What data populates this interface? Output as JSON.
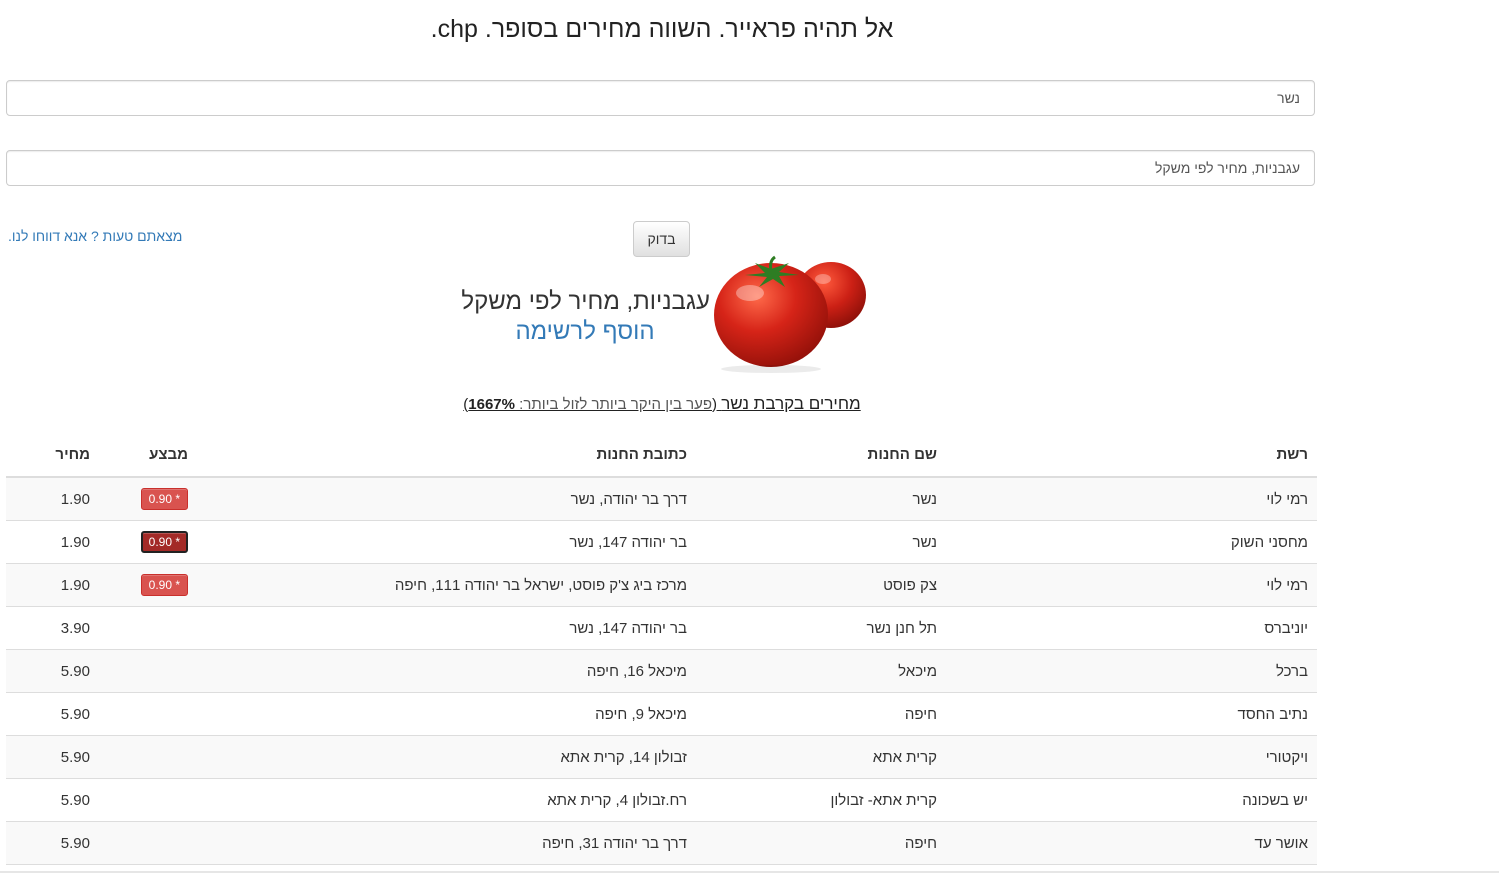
{
  "header": {
    "title": "אל תהיה פראייר. השווה מחירים בסופר. chp."
  },
  "search": {
    "city_value": "נשר",
    "product_value": "עגבניות, מחיר לפי משקל",
    "check_button": "בדוק",
    "report_link": "מצאתם טעות ? אנא דווחו לנו."
  },
  "product": {
    "name": "עגבניות, מחיר לפי משקל",
    "add_to_list": "הוסף לרשימה",
    "image_icon": "tomato-image",
    "colors": {
      "tomato": "#d62418",
      "leaf": "#2e7d23"
    }
  },
  "prices": {
    "heading_main": "מחירים בקרבת נשר",
    "heading_gap_label": "פער בין היקר ביותר לזול ביותר: ",
    "heading_gap_value": "1667%",
    "heading_open": " (",
    "heading_close": ")",
    "columns": {
      "chain": "רשת",
      "store": "שם החנות",
      "address": "כתובת החנות",
      "promo": "מבצע",
      "price": "מחיר"
    },
    "rows": [
      {
        "chain": "רמי לוי",
        "store": "נשר",
        "address": "דרך בר יהודה, נשר",
        "promo": "0.90 *",
        "price": "1.90"
      },
      {
        "chain": "מחסני השוק",
        "store": "נשר",
        "address": "בר יהודה 147, נשר",
        "promo": "0.90 *",
        "price": "1.90"
      },
      {
        "chain": "רמי לוי",
        "store": "צק פוסט",
        "address": "מרכז ביג צ'ק פוסט, ישראל בר יהודה 111, חיפה",
        "promo": "0.90 *",
        "price": "1.90"
      },
      {
        "chain": "יוניברס",
        "store": "תל חנן נשר",
        "address": "בר יהודה 147, נשר",
        "promo": "",
        "price": "3.90"
      },
      {
        "chain": "ברכל",
        "store": "מיכאל",
        "address": "מיכאל 16, חיפה",
        "promo": "",
        "price": "5.90"
      },
      {
        "chain": "נתיב החסד",
        "store": "חיפה",
        "address": "מיכאל 9, חיפה",
        "promo": "",
        "price": "5.90"
      },
      {
        "chain": "ויקטורי",
        "store": "קרית אתא",
        "address": "זבולון 14, קרית אתא",
        "promo": "",
        "price": "5.90"
      },
      {
        "chain": "יש בשכונה",
        "store": "קרית אתא- זבולון",
        "address": "רח.זבולון 4, קרית אתא",
        "promo": "",
        "price": "5.90"
      },
      {
        "chain": "אושר עד",
        "store": "חיפה",
        "address": "דרך בר יהודה 31, חיפה",
        "promo": "",
        "price": "5.90"
      }
    ]
  },
  "theme": {
    "link": "#337ab7",
    "promo_badge": "#d9534f",
    "stripe": "#f9f9f9",
    "border": "#dddddd"
  }
}
